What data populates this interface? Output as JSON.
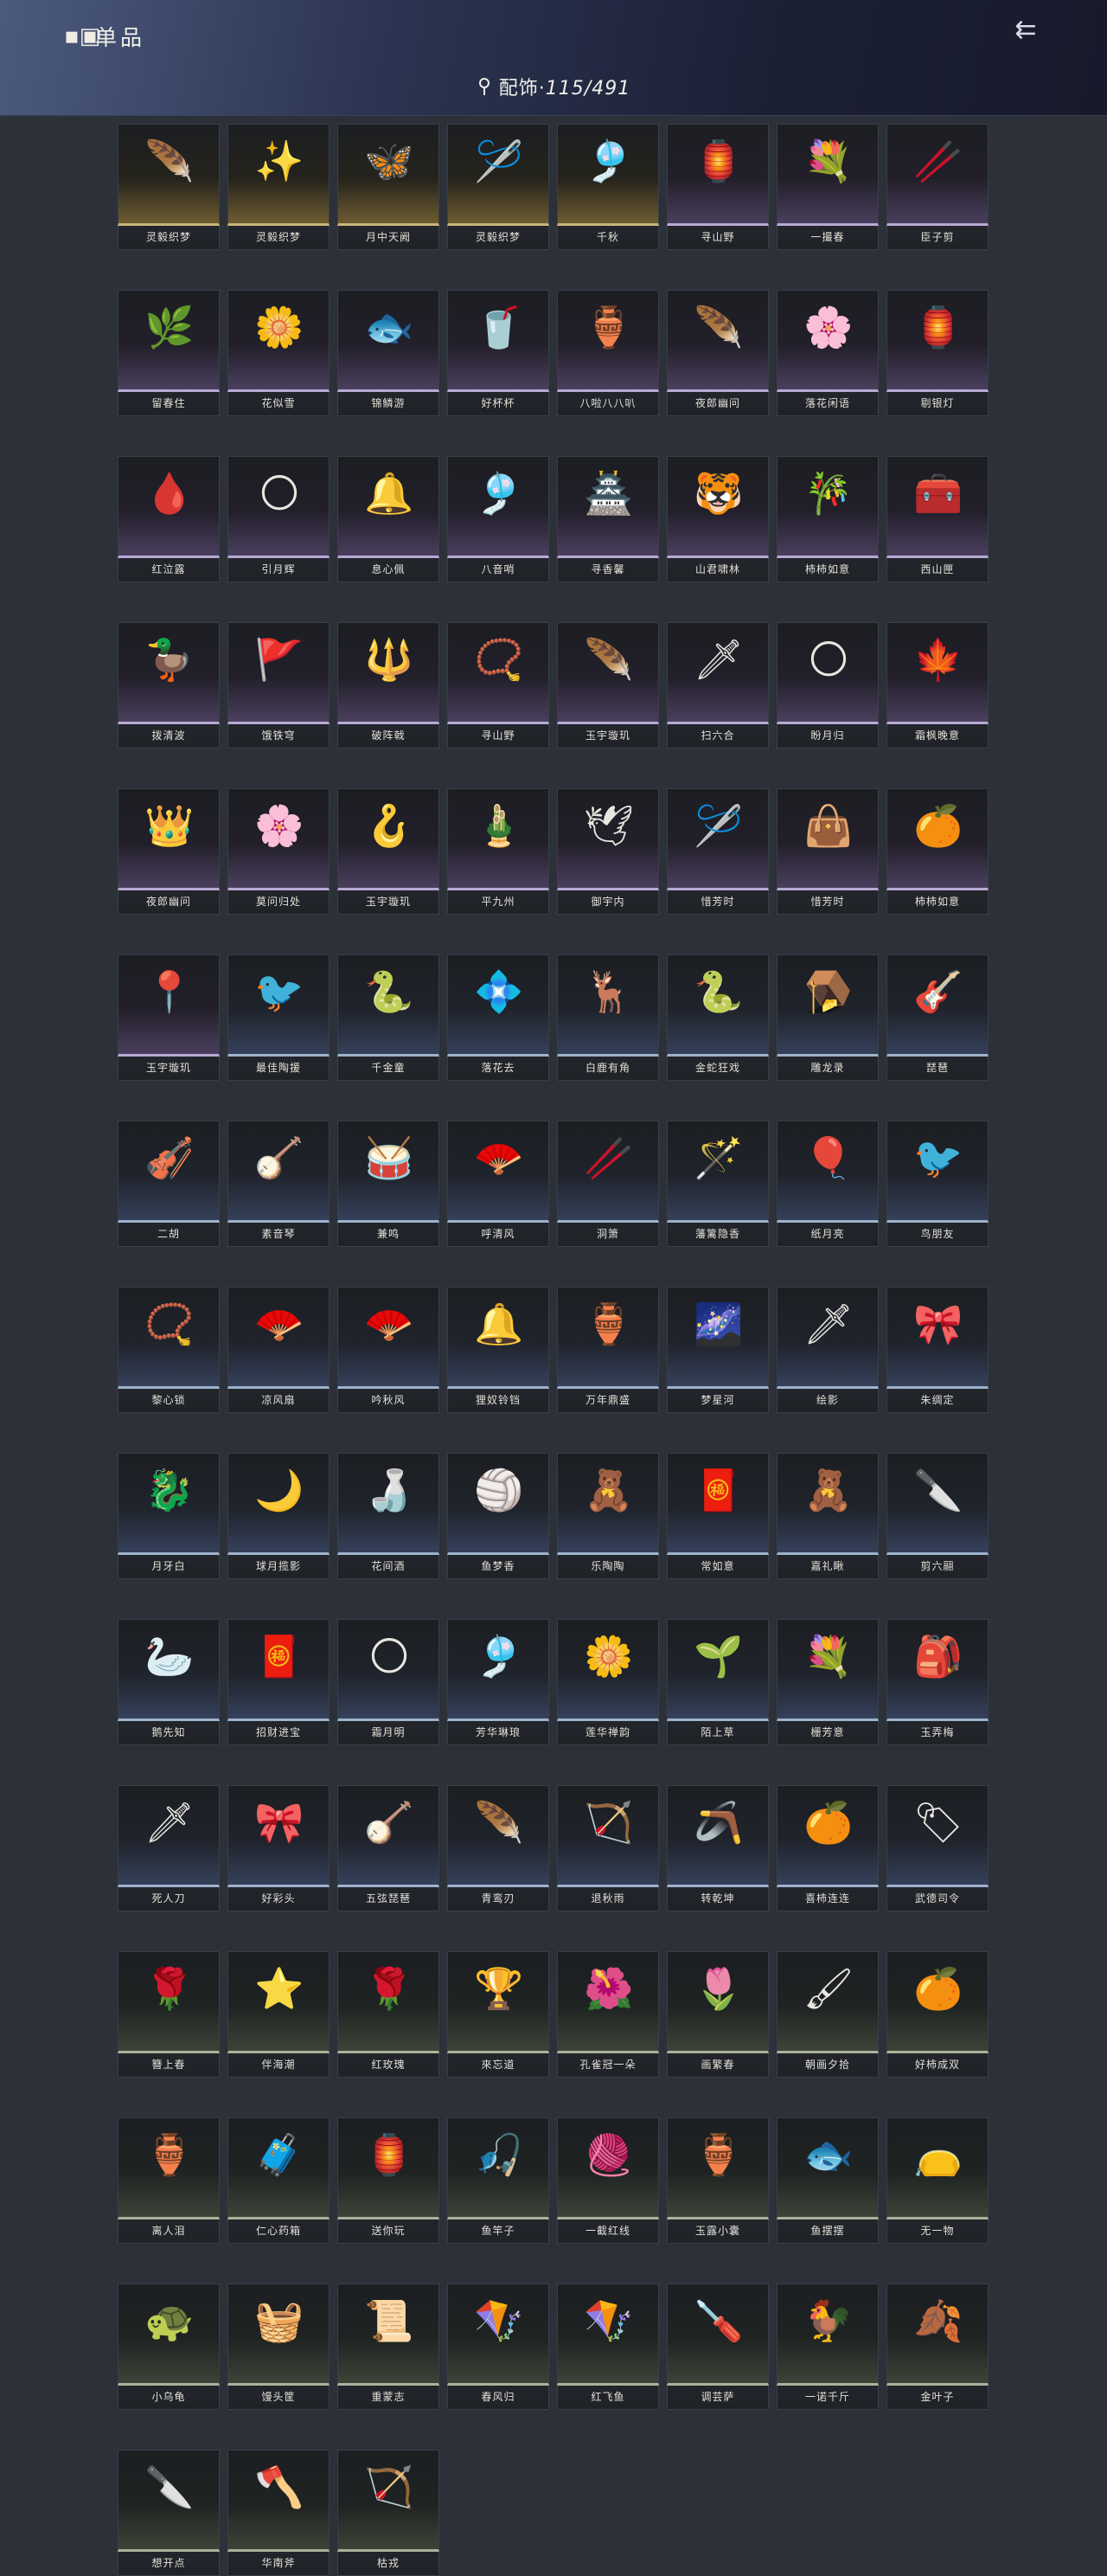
{
  "header": {
    "logo_glyph": "▪▣",
    "title": "单品",
    "back_glyph": "⇇",
    "category_label": "配饰·",
    "category_count": "115/491"
  },
  "items": [
    {
      "name": "灵毅织梦",
      "icon": "🪶",
      "tone": "gold"
    },
    {
      "name": "灵毅织梦",
      "icon": "✨",
      "tone": "gold"
    },
    {
      "name": "月中天阙",
      "icon": "🦋",
      "tone": "gold"
    },
    {
      "name": "灵毅织梦",
      "icon": "🪡",
      "tone": "gold"
    },
    {
      "name": "千秋",
      "icon": "🎐",
      "tone": "gold"
    },
    {
      "name": "寻山野",
      "icon": "🏮",
      "tone": "purple"
    },
    {
      "name": "一撮春",
      "icon": "💐",
      "tone": "purple"
    },
    {
      "name": "臣子剪",
      "icon": "🥢",
      "tone": "purple"
    },
    {
      "name": "留春住",
      "icon": "🌿",
      "tone": "purple"
    },
    {
      "name": "花似雪",
      "icon": "🌼",
      "tone": "purple"
    },
    {
      "name": "锦鳞游",
      "icon": "🐟",
      "tone": "purple"
    },
    {
      "name": "好杯杯",
      "icon": "🥤",
      "tone": "purple"
    },
    {
      "name": "八啦八八叭",
      "icon": "🏺",
      "tone": "purple"
    },
    {
      "name": "夜郎幽问",
      "icon": "🪶",
      "tone": "purple"
    },
    {
      "name": "落花闲语",
      "icon": "🌸",
      "tone": "purple"
    },
    {
      "name": "剔银灯",
      "icon": "🏮",
      "tone": "purple"
    },
    {
      "name": "红泣露",
      "icon": "🩸",
      "tone": "purple"
    },
    {
      "name": "引月辉",
      "icon": "🌕",
      "tone": "purple"
    },
    {
      "name": "息心佩",
      "icon": "🔔",
      "tone": "purple"
    },
    {
      "name": "八音哨",
      "icon": "🎐",
      "tone": "purple"
    },
    {
      "name": "寻香馨",
      "icon": "🏯",
      "tone": "purple"
    },
    {
      "name": "山君啸林",
      "icon": "🐯",
      "tone": "purple"
    },
    {
      "name": "柿柿如意",
      "icon": "🎋",
      "tone": "purple"
    },
    {
      "name": "西山匣",
      "icon": "🧰",
      "tone": "purple"
    },
    {
      "name": "拨清波",
      "icon": "🦆",
      "tone": "purple"
    },
    {
      "name": "饿铁穹",
      "icon": "🚩",
      "tone": "purple"
    },
    {
      "name": "破阵戟",
      "icon": "🔱",
      "tone": "purple"
    },
    {
      "name": "寻山野",
      "icon": "📿",
      "tone": "purple"
    },
    {
      "name": "玉宇璇玑",
      "icon": "🪶",
      "tone": "purple"
    },
    {
      "name": "扫六合",
      "icon": "🗡",
      "tone": "purple"
    },
    {
      "name": "盼月归",
      "icon": "🌕",
      "tone": "purple"
    },
    {
      "name": "霜枫晚意",
      "icon": "🍁",
      "tone": "purple"
    },
    {
      "name": "夜郎幽问",
      "icon": "👑",
      "tone": "purple"
    },
    {
      "name": "莫问归处",
      "icon": "🌸",
      "tone": "purple"
    },
    {
      "name": "玉宇璇玑",
      "icon": "🪝",
      "tone": "purple"
    },
    {
      "name": "平九州",
      "icon": "🎍",
      "tone": "purple"
    },
    {
      "name": "御宇内",
      "icon": "🕊",
      "tone": "purple"
    },
    {
      "name": "惜芳时",
      "icon": "🪡",
      "tone": "purple"
    },
    {
      "name": "惜芳时",
      "icon": "👜",
      "tone": "purple"
    },
    {
      "name": "柿柿如意",
      "icon": "🍊",
      "tone": "purple"
    },
    {
      "name": "玉宇璇玑",
      "icon": "📍",
      "tone": "purple"
    },
    {
      "name": "最佳陶援",
      "icon": "🐦",
      "tone": "blue"
    },
    {
      "name": "千金童",
      "icon": "🐍",
      "tone": "blue"
    },
    {
      "name": "落花去",
      "icon": "💠",
      "tone": "blue"
    },
    {
      "name": "白鹿有角",
      "icon": "🦌",
      "tone": "blue"
    },
    {
      "name": "金蛇狂戏",
      "icon": "🐍",
      "tone": "blue"
    },
    {
      "name": "雕龙录",
      "icon": "🪤",
      "tone": "blue"
    },
    {
      "name": "琵琶",
      "icon": "🎸",
      "tone": "blue"
    },
    {
      "name": "二胡",
      "icon": "🎻",
      "tone": "blue"
    },
    {
      "name": "素音琴",
      "icon": "🪕",
      "tone": "blue"
    },
    {
      "name": "兼鸣",
      "icon": "🥁",
      "tone": "blue"
    },
    {
      "name": "呼清风",
      "icon": "🪭",
      "tone": "blue"
    },
    {
      "name": "洞箫",
      "icon": "🥢",
      "tone": "blue"
    },
    {
      "name": "藩篱隐香",
      "icon": "🪄",
      "tone": "blue"
    },
    {
      "name": "纸月亮",
      "icon": "🎈",
      "tone": "blue"
    },
    {
      "name": "鸟朋友",
      "icon": "🐦",
      "tone": "blue"
    },
    {
      "name": "黎心锁",
      "icon": "📿",
      "tone": "blue"
    },
    {
      "name": "凉风扇",
      "icon": "🪭",
      "tone": "blue"
    },
    {
      "name": "吟秋风",
      "icon": "🪭",
      "tone": "blue"
    },
    {
      "name": "狸奴铃铛",
      "icon": "🔔",
      "tone": "blue"
    },
    {
      "name": "万年鼎盛",
      "icon": "🏺",
      "tone": "blue"
    },
    {
      "name": "梦星河",
      "icon": "🌌",
      "tone": "blue"
    },
    {
      "name": "绘影",
      "icon": "🗡",
      "tone": "blue"
    },
    {
      "name": "朱绸定",
      "icon": "🎀",
      "tone": "blue"
    },
    {
      "name": "月牙白",
      "icon": "🐉",
      "tone": "blue"
    },
    {
      "name": "球月揽影",
      "icon": "🌙",
      "tone": "blue"
    },
    {
      "name": "花间酒",
      "icon": "🍶",
      "tone": "blue"
    },
    {
      "name": "鱼梦香",
      "icon": "🏐",
      "tone": "blue"
    },
    {
      "name": "乐陶陶",
      "icon": "🧸",
      "tone": "blue"
    },
    {
      "name": "常如意",
      "icon": "🧧",
      "tone": "blue"
    },
    {
      "name": "嘉礼瞅",
      "icon": "🧸",
      "tone": "blue"
    },
    {
      "name": "剪六翮",
      "icon": "🔪",
      "tone": "blue"
    },
    {
      "name": "鹅先知",
      "icon": "🦢",
      "tone": "blue"
    },
    {
      "name": "招财进宝",
      "icon": "🧧",
      "tone": "blue"
    },
    {
      "name": "霜月明",
      "icon": "🌕",
      "tone": "blue"
    },
    {
      "name": "芳华琳琅",
      "icon": "🎐",
      "tone": "blue"
    },
    {
      "name": "莲华禅韵",
      "icon": "🌼",
      "tone": "blue"
    },
    {
      "name": "陌上草",
      "icon": "🌱",
      "tone": "blue"
    },
    {
      "name": "栅芳意",
      "icon": "💐",
      "tone": "blue"
    },
    {
      "name": "玉弄梅",
      "icon": "🎒",
      "tone": "blue"
    },
    {
      "name": "死人刀",
      "icon": "🗡",
      "tone": "blue"
    },
    {
      "name": "好彩头",
      "icon": "🎀",
      "tone": "blue"
    },
    {
      "name": "五弦琵琶",
      "icon": "🪕",
      "tone": "blue"
    },
    {
      "name": "青鸾刃",
      "icon": "🪶",
      "tone": "blue"
    },
    {
      "name": "退秋雨",
      "icon": "🏹",
      "tone": "blue"
    },
    {
      "name": "转乾坤",
      "icon": "🪃",
      "tone": "blue"
    },
    {
      "name": "喜柿连连",
      "icon": "🍊",
      "tone": "blue"
    },
    {
      "name": "武德司令",
      "icon": "🏷",
      "tone": "blue"
    },
    {
      "name": "簪上春",
      "icon": "🌹",
      "tone": "green"
    },
    {
      "name": "伴海潮",
      "icon": "⭐",
      "tone": "green"
    },
    {
      "name": "红玫瑰",
      "icon": "🌹",
      "tone": "green"
    },
    {
      "name": "來忘道",
      "icon": "🏆",
      "tone": "green"
    },
    {
      "name": "孔雀冠一朵",
      "icon": "🌺",
      "tone": "green"
    },
    {
      "name": "画繁春",
      "icon": "🌷",
      "tone": "green"
    },
    {
      "name": "朝画夕拾",
      "icon": "🖌",
      "tone": "green"
    },
    {
      "name": "好柿成双",
      "icon": "🍊",
      "tone": "green"
    },
    {
      "name": "离人泪",
      "icon": "🏺",
      "tone": "green"
    },
    {
      "name": "仁心药箱",
      "icon": "🧳",
      "tone": "green"
    },
    {
      "name": "送你玩",
      "icon": "🏮",
      "tone": "green"
    },
    {
      "name": "鱼竿子",
      "icon": "🎣",
      "tone": "green"
    },
    {
      "name": "一截红线",
      "icon": "🧶",
      "tone": "green"
    },
    {
      "name": "玉露小囊",
      "icon": "🏺",
      "tone": "green"
    },
    {
      "name": "鱼摆摆",
      "icon": "🐟",
      "tone": "green"
    },
    {
      "name": "无一物",
      "icon": "👝",
      "tone": "green"
    },
    {
      "name": "小乌龟",
      "icon": "🐢",
      "tone": "green"
    },
    {
      "name": "馒头筐",
      "icon": "🧺",
      "tone": "green"
    },
    {
      "name": "重蒙志",
      "icon": "📜",
      "tone": "green"
    },
    {
      "name": "春风归",
      "icon": "🪁",
      "tone": "green"
    },
    {
      "name": "红飞鱼",
      "icon": "🪁",
      "tone": "green"
    },
    {
      "name": "调芸萨",
      "icon": "🪛",
      "tone": "green"
    },
    {
      "name": "一诺千斤",
      "icon": "🐓",
      "tone": "green"
    },
    {
      "name": "金叶子",
      "icon": "🍂",
      "tone": "green"
    },
    {
      "name": "想开点",
      "icon": "🔪",
      "tone": "green"
    },
    {
      "name": "华南斧",
      "icon": "🪓",
      "tone": "green"
    },
    {
      "name": "枯戎",
      "icon": "🏹",
      "tone": "green"
    }
  ]
}
